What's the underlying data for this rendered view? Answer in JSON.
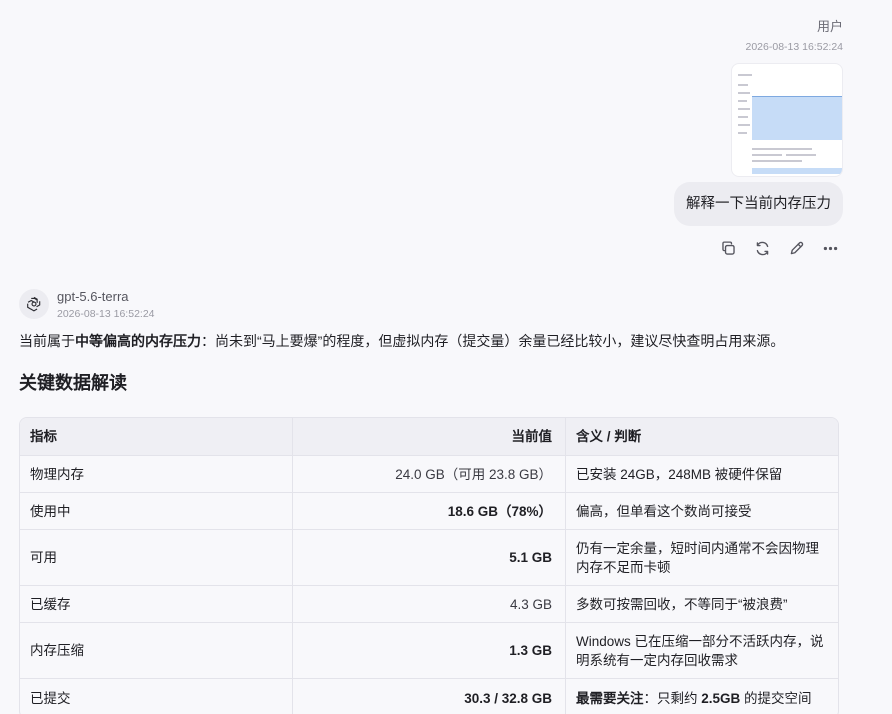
{
  "user": {
    "name": "用户",
    "time": "2026-08-13 16:52:24",
    "message": "解释一下当前内存压力"
  },
  "assistant": {
    "name": "gpt-5.6-terra",
    "time": "2026-08-13 16:52:24",
    "summary_prefix": "当前属于",
    "summary_bold": "中等偏高的内存压力",
    "summary_rest": "：尚未到“马上要爆”的程度，但虚拟内存（提交量）余量已经比较小，建议尽快查明占用来源。",
    "section_title": "关键数据解读"
  },
  "table": {
    "headers": [
      "指标",
      "当前值",
      "含义 / 判断"
    ],
    "rows": [
      {
        "metric": "物理内存",
        "value": "24.0 GB（可用 23.8 GB）",
        "meaning": "已安装 24GB，248MB 被硬件保留"
      },
      {
        "metric": "使用中",
        "value": "18.6 GB（78%）",
        "meaning": "偏高，但单看这个数尚可接受"
      },
      {
        "metric": "可用",
        "value": "5.1 GB",
        "meaning": "仍有一定余量，短时间内通常不会因物理内存不足而卡顿"
      },
      {
        "metric": "已缓存",
        "value": "4.3 GB",
        "meaning": "多数可按需回收，不等同于“被浪费”"
      },
      {
        "metric": "内存压缩",
        "value": "1.3 GB",
        "meaning": "Windows 已在压缩一部分不活跃内存，说明系统有一定内存回收需求"
      },
      {
        "metric": "已提交",
        "value": "30.3 / 32.8 GB",
        "meaning_bold": "最需要关注",
        "meaning_mid": "：只剩约 ",
        "meaning_bold2": "2.5GB",
        "meaning_end": " 的提交空间"
      }
    ]
  },
  "icons": [
    "copy-icon",
    "regenerate-icon",
    "edit-icon",
    "more-icon",
    "openai-logo-icon"
  ],
  "colors": {
    "accent_chart": "#c6dcf7",
    "bubble_bg": "#ececf1",
    "page_bg": "#f8f8fb"
  }
}
